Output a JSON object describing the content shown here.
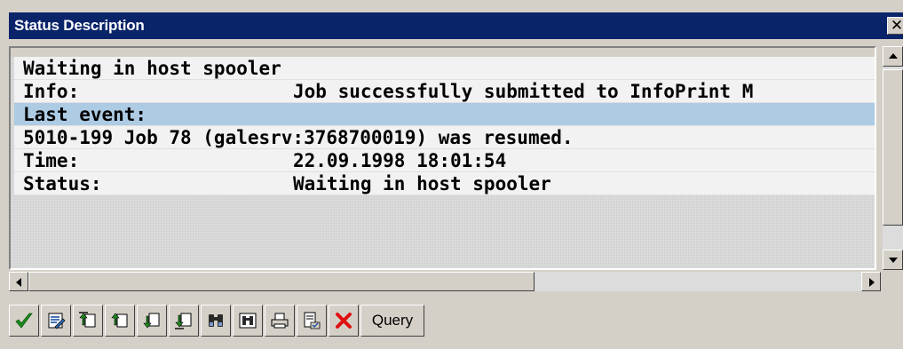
{
  "window": {
    "title": "Status Description",
    "close_glyph": "✕"
  },
  "rows": [
    {
      "label": "Waiting in host spooler",
      "value": ""
    },
    {
      "label": "Info:",
      "value": "Job successfully submitted to InfoPrint M"
    },
    {
      "label": "Last event:",
      "value": ""
    },
    {
      "label": "5010-199 Job 78 (galesrv:3768700019) was resumed.",
      "value": ""
    },
    {
      "label": "Time:",
      "value": "22.09.1998 18:01:54"
    },
    {
      "label": "Status:",
      "value": "Waiting in host spooler"
    }
  ],
  "toolbar": {
    "buttons": [
      "check-icon",
      "edit-icon",
      "first-page-icon",
      "previous-page-icon",
      "next-page-icon",
      "last-page-icon",
      "find-icon",
      "find-next-icon",
      "print-icon",
      "attributes-icon",
      "cancel-icon"
    ],
    "query_label": "Query"
  },
  "colors": {
    "titlebar": "#0a246a",
    "highlight_row": "#aecbe4",
    "check": "#1e8a1e",
    "cancel": "#e01010"
  }
}
